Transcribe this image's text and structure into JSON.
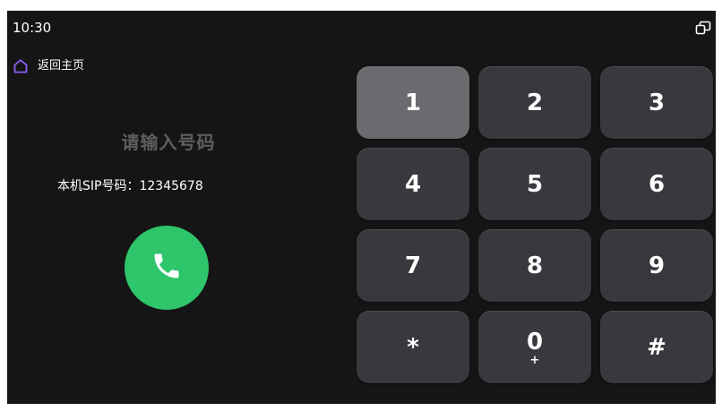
{
  "status_bar": {
    "time": "10:30",
    "window_icon": "window-restore-icon"
  },
  "nav": {
    "home_label": "返回主页",
    "home_icon": "home-icon"
  },
  "dialer": {
    "placeholder": "请输入号码",
    "sip_label": "本机SIP号码：",
    "sip_number": "12345678",
    "call_icon": "phone-icon"
  },
  "keypad": {
    "keys": [
      {
        "digit": "1",
        "sub": ""
      },
      {
        "digit": "2",
        "sub": ""
      },
      {
        "digit": "3",
        "sub": ""
      },
      {
        "digit": "4",
        "sub": ""
      },
      {
        "digit": "5",
        "sub": ""
      },
      {
        "digit": "6",
        "sub": ""
      },
      {
        "digit": "7",
        "sub": ""
      },
      {
        "digit": "8",
        "sub": ""
      },
      {
        "digit": "9",
        "sub": ""
      },
      {
        "digit": "*",
        "sub": ""
      },
      {
        "digit": "0",
        "sub": "+"
      },
      {
        "digit": "#",
        "sub": ""
      }
    ],
    "pressed_key": "1"
  },
  "colors": {
    "background": "#151515",
    "key": "#38383e",
    "key_pressed": "#6a6a6f",
    "call_green": "#2ec56b",
    "home_icon": "#8b5cf6",
    "placeholder": "#5e5e5e"
  }
}
